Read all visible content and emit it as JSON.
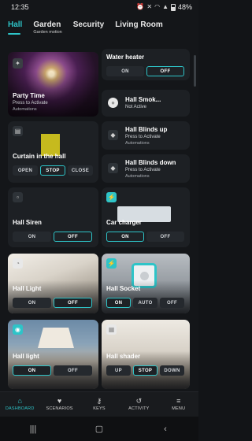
{
  "status": {
    "time": "12:35",
    "battery": "48%"
  },
  "tabs": [
    {
      "label": "Hall",
      "sub": ""
    },
    {
      "label": "Garden",
      "sub": "Garden motion"
    },
    {
      "label": "Security",
      "sub": ""
    },
    {
      "label": "Living Room",
      "sub": ""
    }
  ],
  "cards": {
    "water_heater": {
      "title": "Water heater",
      "on": "ON",
      "off": "OFF"
    },
    "party_time": {
      "title": "Party Time",
      "sub": "Press to Activate",
      "sub2": "Automations"
    },
    "hall_smoke": {
      "title": "Hall Smok...",
      "sub": "Not Active"
    },
    "curtain": {
      "title": "Curtain in the hall",
      "open": "OPEN",
      "stop": "STOP",
      "close": "CLOSE"
    },
    "blinds_up": {
      "title": "Hall Blinds up",
      "sub": "Press to Activate",
      "sub2": "Automations"
    },
    "blinds_down": {
      "title": "Hall Blinds down",
      "sub": "Press to Activate",
      "sub2": "Automations"
    },
    "siren": {
      "title": "Hall Siren",
      "on": "ON",
      "off": "OFF"
    },
    "car_charger": {
      "title": "Car charger",
      "on": "ON",
      "off": "OFF"
    },
    "hall_light": {
      "title": "Hall Light",
      "on": "ON",
      "off": "OFF"
    },
    "hall_socket": {
      "title": "Hall Socket",
      "on": "ON",
      "auto": "AUTO",
      "off": "OFF"
    },
    "hall_light2": {
      "title": "Hall light",
      "on": "ON",
      "off": "OFF"
    },
    "hall_shader": {
      "title": "Hall shader",
      "up": "UP",
      "stop": "STOP",
      "down": "DOWN"
    }
  },
  "nav": {
    "dashboard": "DASHBOARD",
    "scenarios": "SCENARIOS",
    "keys": "KEYS",
    "activity": "ACTIVITY",
    "menu": "MENU"
  },
  "colors": {
    "accent": "#2ec4c8",
    "background": "#141619",
    "card": "#1d2024"
  }
}
